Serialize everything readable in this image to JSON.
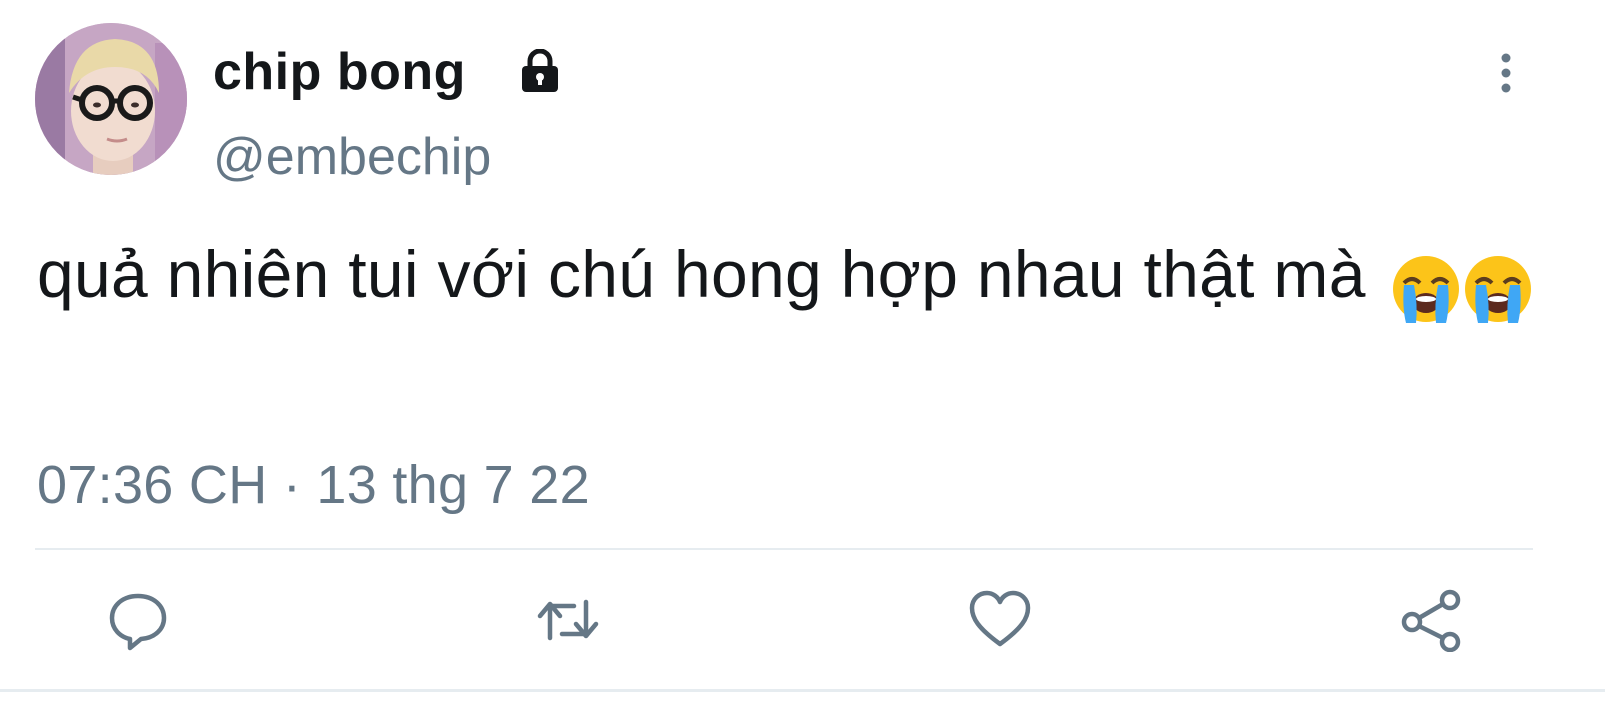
{
  "author": {
    "display_name": "chip bong",
    "handle": "@embechip",
    "protected_icon": "lock-icon",
    "avatar_icon": "avatar-photo"
  },
  "tweet": {
    "text": "quả nhiên tui với chú hong hợp nhau thật mà",
    "emojis": [
      "loudly-crying-face-emoji",
      "loudly-crying-face-emoji"
    ],
    "timestamp": "07:36 CH · 13 thg 7 22"
  },
  "menu": {
    "icon": "more-vertical-icon"
  },
  "actions": [
    {
      "name": "reply",
      "icon": "reply-icon"
    },
    {
      "name": "retweet",
      "icon": "retweet-icon"
    },
    {
      "name": "like",
      "icon": "heart-icon"
    },
    {
      "name": "share",
      "icon": "share-icon"
    }
  ],
  "colors": {
    "text_primary": "#14171a",
    "text_secondary": "#657786",
    "divider": "#e6ecf0",
    "icon": "#657786"
  }
}
